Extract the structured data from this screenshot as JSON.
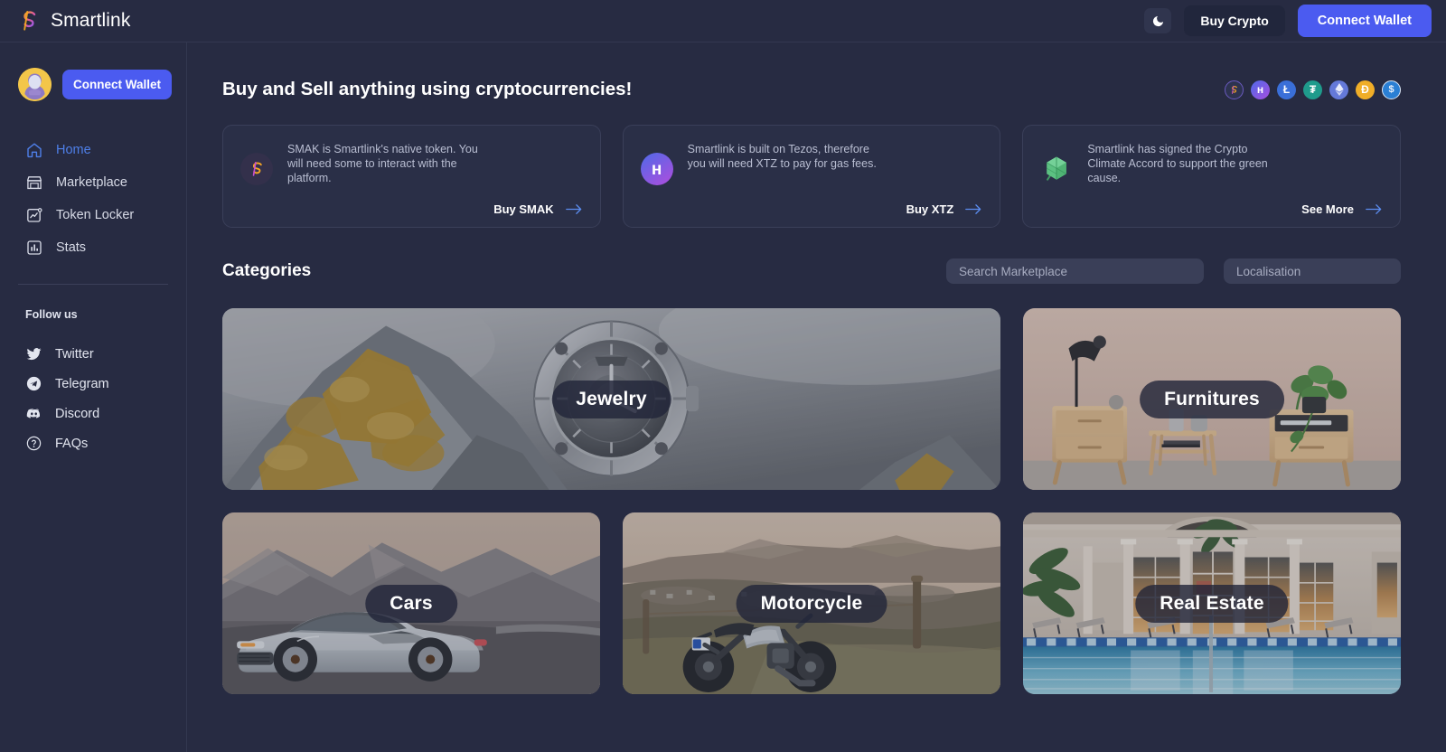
{
  "topbar": {
    "brand_name": "Smartlink",
    "brand_logo_icon": "smartlink-s-logo",
    "theme_toggle_icon": "moon-icon",
    "buy_crypto_label": "Buy Crypto",
    "connect_wallet_label": "Connect Wallet"
  },
  "sidebar": {
    "avatar_icon": "user-avatar",
    "connect_wallet_label": "Connect Wallet",
    "nav": [
      {
        "label": "Home",
        "icon": "home-icon",
        "active": true
      },
      {
        "label": "Marketplace",
        "icon": "storefront-icon",
        "active": false
      },
      {
        "label": "Token Locker",
        "icon": "chart-lock-icon",
        "active": false
      },
      {
        "label": "Stats",
        "icon": "bar-chart-icon",
        "active": false
      }
    ],
    "follow_label": "Follow us",
    "social": [
      {
        "label": "Twitter",
        "icon": "twitter-icon"
      },
      {
        "label": "Telegram",
        "icon": "telegram-icon"
      },
      {
        "label": "Discord",
        "icon": "discord-icon"
      },
      {
        "label": "FAQs",
        "icon": "question-circle-icon"
      }
    ]
  },
  "main": {
    "page_title": "Buy and Sell anything using cryptocurrencies!",
    "coins": [
      {
        "name": "smak-coin",
        "symbol": "S",
        "color": "#2d3350"
      },
      {
        "name": "tezos-coin",
        "symbol": "Ƨ",
        "color": "#7b4fe0"
      },
      {
        "name": "litecoin-coin",
        "symbol": "Ł",
        "color": "#3a6fd8"
      },
      {
        "name": "tether-coin",
        "symbol": "₮",
        "color": "#21998a"
      },
      {
        "name": "ethereum-coin",
        "symbol": "♦",
        "color": "#6479d9"
      },
      {
        "name": "dai-coin",
        "symbol": "D",
        "color": "#f0ae28"
      },
      {
        "name": "usdc-coin",
        "symbol": "$",
        "color": "#2a7fd4"
      }
    ],
    "info_cards": [
      {
        "icon": "smak-token-icon",
        "text": "SMAK is Smartlink's native token. You will need some to interact with the platform.",
        "action_label": "Buy SMAK",
        "action_icon": "arrow-right-icon"
      },
      {
        "icon": "tezos-token-icon",
        "text": "Smartlink is built on Tezos, therefore you will need XTZ to pay for gas fees.",
        "action_label": "Buy XTZ",
        "action_icon": "arrow-right-icon"
      },
      {
        "icon": "crypto-climate-accord-icon",
        "text": "Smartlink has signed the Crypto Climate Accord to support the green cause.",
        "action_label": "See More",
        "action_icon": "arrow-right-icon"
      }
    ],
    "categories_title": "Categories",
    "search_marketplace_placeholder": "Search Marketplace",
    "search_marketplace_value": "",
    "search_localisation_placeholder": "Localisation",
    "search_localisation_value": "",
    "categories": [
      {
        "label": "Jewelry",
        "image": "watch-on-mountain-rock"
      },
      {
        "label": "Furnitures",
        "image": "wooden-furniture-room"
      },
      {
        "label": "Cars",
        "image": "silver-car-mountain-road"
      },
      {
        "label": "Motorcycle",
        "image": "motorcycle-on-hillside"
      },
      {
        "label": "Real Estate",
        "image": "mansion-with-pool"
      }
    ]
  },
  "colors": {
    "background": "#272b42",
    "card_background": "#2a2f47",
    "accent_blue": "#4b5bf0",
    "active_nav": "#4e7fe8",
    "border": "#3a3f59",
    "input_background": "#3a3f58",
    "muted_text": "#b9bed2"
  }
}
